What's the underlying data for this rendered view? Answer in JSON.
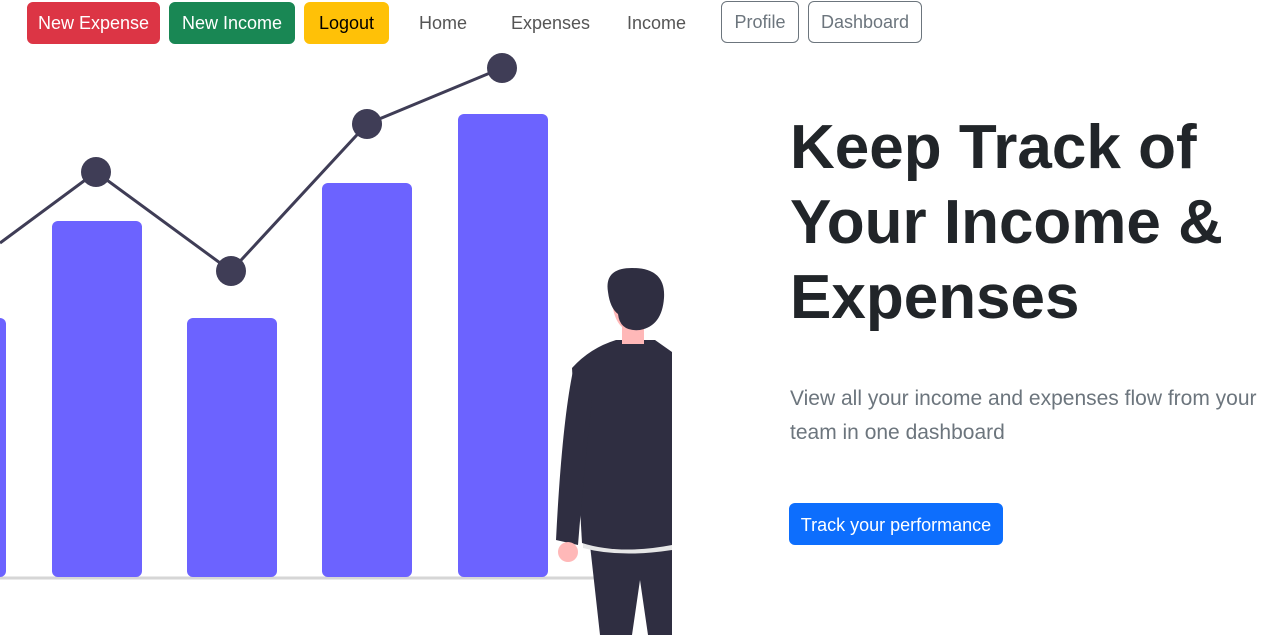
{
  "nav": {
    "new_expense": "New Expense",
    "new_income": "New Income",
    "logout": "Logout",
    "home": "Home",
    "expenses": "Expenses",
    "income": "Income",
    "profile": "Profile",
    "dashboard": "Dashboard"
  },
  "hero": {
    "title": "Keep Track of Your Income & Expenses",
    "subtitle": "View all your income and expenses flow from your team in one dashboard",
    "cta": "Track your performance"
  },
  "colors": {
    "danger": "#dc3545",
    "success": "#198754",
    "warning": "#ffc107",
    "primary": "#0d6efd",
    "bar": "#6c63ff",
    "line": "#3f3d56",
    "person": "#2f2e41",
    "skin": "#ffb8b8"
  }
}
